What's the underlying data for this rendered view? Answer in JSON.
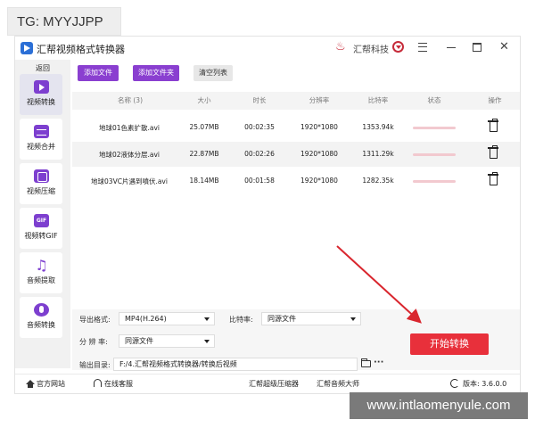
{
  "watermarks": {
    "top_left": "TG: MYYJJPP",
    "bottom_right": "www.intlaomenyule.com"
  },
  "titlebar": {
    "title": "汇帮视频格式转换器",
    "brand": "汇帮科技"
  },
  "sidebar": {
    "back": "返回",
    "items": [
      {
        "label": "视频转换",
        "icon": "video-convert-icon"
      },
      {
        "label": "视频合并",
        "icon": "video-merge-icon"
      },
      {
        "label": "视频压缩",
        "icon": "video-compress-icon"
      },
      {
        "label": "视频转GIF",
        "icon": "gif-icon"
      },
      {
        "label": "音频提取",
        "icon": "music-icon"
      },
      {
        "label": "音频转换",
        "icon": "audio-convert-icon"
      }
    ]
  },
  "toolbar": {
    "add_file": "添加文件",
    "add_folder": "添加文件夹",
    "clear_list": "清空列表"
  },
  "table": {
    "headers": [
      "名称 (3)",
      "大小",
      "时长",
      "分辨率",
      "比特率",
      "状态",
      "操作"
    ],
    "rows": [
      {
        "name": "地球01色素扩散.avi",
        "size": "25.07MB",
        "duration": "00:02:35",
        "resolution": "1920*1080",
        "bitrate": "1353.94k"
      },
      {
        "name": "地球02液体分层.avi",
        "size": "22.87MB",
        "duration": "00:02:26",
        "resolution": "1920*1080",
        "bitrate": "1311.29k"
      },
      {
        "name": "地球03VC片遇到噴伏.avi",
        "size": "18.14MB",
        "duration": "00:01:58",
        "resolution": "1920*1080",
        "bitrate": "1282.35k"
      }
    ]
  },
  "settings": {
    "output_format_label": "导出格式:",
    "output_format_value": "MP4(H.264)",
    "bitrate_label": "比特率:",
    "bitrate_value": "同源文件",
    "resolution_label": "分 辨 率:",
    "resolution_value": "同源文件",
    "output_dir_label": "输出目录:",
    "output_dir_value": "F:/4.汇帮视频格式转换器/转换后视频",
    "start_button": "开始转换"
  },
  "footer": {
    "official_site": "官方网站",
    "online_support": "在线客服",
    "compressor": "汇帮超级压缩器",
    "audio_master": "汇帮音频大师",
    "version": "版本: 3.6.0.0"
  },
  "colors": {
    "accent_purple": "#8a3fd0",
    "start_red": "#e8303b",
    "brand_red": "#c62b3a"
  }
}
